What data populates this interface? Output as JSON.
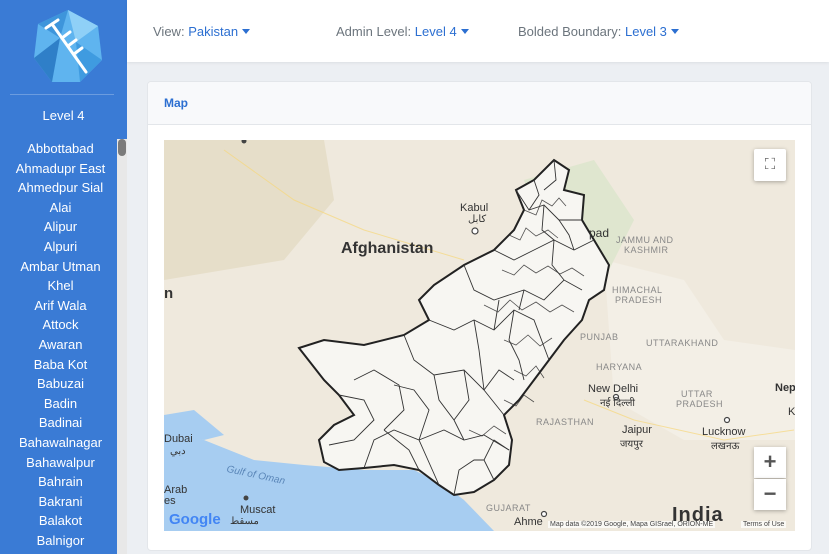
{
  "toolbar": {
    "view": {
      "label": "View:",
      "value": "Pakistan"
    },
    "admin_level": {
      "label": "Admin Level:",
      "value": "Level 4"
    },
    "bolded_boundary": {
      "label": "Bolded Boundary:",
      "value": "Level 3"
    }
  },
  "sidebar": {
    "title": "Level 4",
    "items": [
      "Abbottabad",
      "Ahmadupr East",
      "Ahmedpur Sial",
      "Alai",
      "Alipur",
      "Alpuri",
      "Ambar Utman",
      "Khel",
      "Arif Wala",
      "Attock",
      "Awaran",
      "Baba Kot",
      "Babuzai",
      "Badin",
      "Badinai",
      "Bahawalnagar",
      "Bahawalpur",
      "Bahrain",
      "Bakrani",
      "Balakot",
      "Balnigor"
    ]
  },
  "card": {
    "title": "Map"
  },
  "map": {
    "labels": {
      "afghanistan": "Afghanistan",
      "kabul": "Kabul",
      "kabul_local": "کابل",
      "n_edge": "n",
      "jammu": "JAMMU AND",
      "kashmir": "KASHMIR",
      "pad": "pad",
      "himachal": "HIMACHAL",
      "pradesh": "PRADESH",
      "punjab": "PUNJAB",
      "uttarakhand": "UTTARAKHAND",
      "haryana": "HARYANA",
      "new_delhi": "New Delhi",
      "new_delhi_local": "नई दिल्ली",
      "uttar": "UTTAR",
      "uttar_pradesh": "PRADESH",
      "nep": "Nep",
      "k_edge": "K",
      "rajasthan": "RAJASTHAN",
      "jaipur": "Jaipur",
      "jaipur_local": "जयपुर",
      "lucknow": "Lucknow",
      "lucknow_local": "लखनऊ",
      "dubai": "Dubai",
      "dubai_local": "دبي",
      "gulf": "Gulf of Oman",
      "arab": "Arab",
      "es": "es",
      "muscat": "Muscat",
      "muscat_local": "مسقط",
      "gujarat": "GUJARAT",
      "ahme": "Ahme",
      "india": "India",
      "attribution": "Map data ©2019 Google, Mapa GISrael, ORION-ME",
      "terms": "Terms of Use",
      "google": "Google"
    },
    "controls": {
      "fullscreen_icon": "⛶",
      "zoom_in": "+",
      "zoom_out": "−"
    }
  }
}
